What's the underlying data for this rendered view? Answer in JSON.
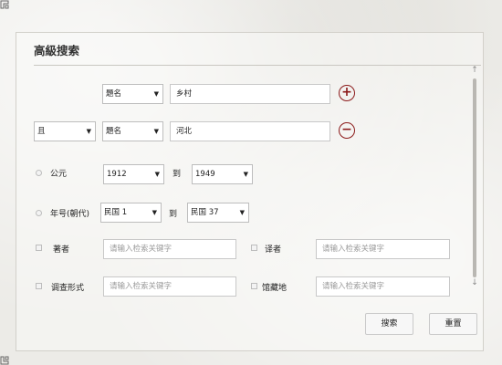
{
  "dialog": {
    "title": "高級搜索"
  },
  "row1": {
    "field": "題名",
    "value": "乡村",
    "add_button": "+"
  },
  "row2": {
    "operator": "且",
    "field": "題名",
    "value": "河北",
    "remove_button": "−"
  },
  "date_gregorian": {
    "label": "公元",
    "from": "1912",
    "to_label": "到",
    "to": "1949"
  },
  "date_era": {
    "label": "年号(朝代)",
    "from": "民国 1",
    "to_label": "到",
    "to": "民国 37"
  },
  "filters": {
    "author": {
      "label": "著者",
      "placeholder": "请输入检索关键字"
    },
    "translator": {
      "label": "译者",
      "placeholder": "请输入检索关键字"
    },
    "survey_form": {
      "label": "调查形式",
      "placeholder": "请输入检索关键字"
    },
    "collection": {
      "label": "馆藏地",
      "placeholder": "请输入检索关键字"
    }
  },
  "buttons": {
    "search": "搜索",
    "reset": "重置"
  },
  "icons": {
    "dropdown": "chevron-down-icon",
    "scroll_up": "arrow-up-icon",
    "scroll_down": "arrow-down-icon"
  },
  "colors": {
    "accent": "#8b1a1a",
    "background": "#ecebe7"
  }
}
